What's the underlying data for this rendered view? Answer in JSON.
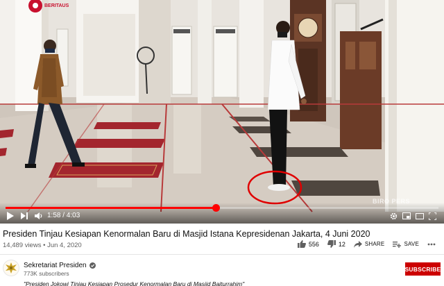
{
  "player": {
    "current_time": "1:58",
    "duration": "4:03",
    "time_display": "1:58 / 4:03",
    "progress_fraction": 0.486,
    "watermark": "BIRO PERS",
    "logo_text": "BERITAUS",
    "accent_color": "#ff0000",
    "annotation_color": "#e00000"
  },
  "video": {
    "title": "Presiden Tinjau Kesiapan Kenormalan Baru di Masjid Istana Kepresidenan Jakarta, 4 Juni 2020",
    "views": "14,489 views",
    "date": "Jun 4, 2020",
    "likes": "556",
    "dislikes": "12",
    "share_label": "SHARE",
    "save_label": "SAVE"
  },
  "channel": {
    "name": "Sekretariat Presiden",
    "subscribers": "773K subscribers",
    "subscribe_label": "SUBSCRIBE",
    "subscribe_color": "#cc0000"
  },
  "description": {
    "first_line": "\"Presiden Jokowi Tinjau Kesiapan Prosedur Kenormalan Baru di Masjid Baiturrahim\""
  }
}
